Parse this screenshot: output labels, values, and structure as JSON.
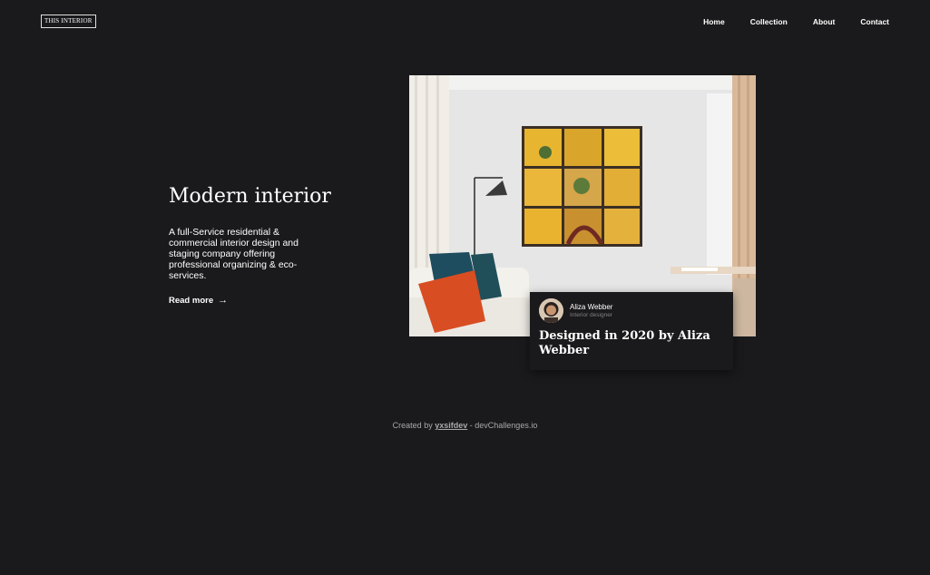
{
  "header": {
    "logo": "THIS INTERIOR",
    "nav": [
      "Home",
      "Collection",
      "About",
      "Contact"
    ]
  },
  "hero": {
    "title": "Modern interior",
    "description": "A full-Service residential & commercial interior design and staging company offering professional organizing & eco-services.",
    "read_more": "Read more",
    "read_more_arrow": "→"
  },
  "card": {
    "name": "Aliza Webber",
    "role": "Interior designer",
    "title": "Designed in 2020 by Aliza Webber"
  },
  "footer": {
    "prefix": "Created by",
    "author": "yxsifdev",
    "separator": "-",
    "site": "devChallenges.io"
  },
  "colors": {
    "background": "#1a191b",
    "text": "#ffffff",
    "muted": "#828282"
  }
}
